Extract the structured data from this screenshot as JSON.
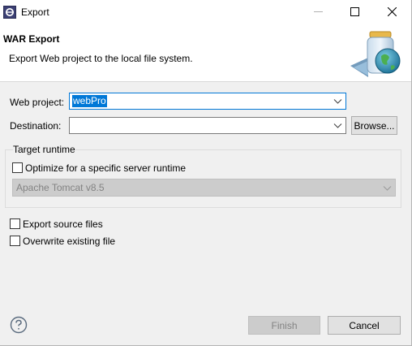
{
  "window": {
    "title": "Export"
  },
  "banner": {
    "title": "WAR Export",
    "description": "Export Web project to the local file system."
  },
  "form": {
    "web_project_label": "Web project:",
    "web_project_value": "webPro",
    "destination_label": "Destination:",
    "destination_value": "",
    "browse_label": "Browse..."
  },
  "target_runtime": {
    "group_title": "Target runtime",
    "optimize_label": "Optimize for a specific server runtime",
    "optimize_checked": false,
    "runtime_value": "Apache Tomcat v8.5"
  },
  "options": {
    "export_source_label": "Export source files",
    "export_source_checked": false,
    "overwrite_label": "Overwrite existing file",
    "overwrite_checked": false
  },
  "footer": {
    "finish_label": "Finish",
    "cancel_label": "Cancel"
  },
  "colors": {
    "accent": "#0078d7",
    "window_bg": "#f0f0f0",
    "disabled_bg": "#cccccc"
  },
  "icons": {
    "app": "eclipse-icon",
    "minimize": "minimize-icon",
    "maximize": "maximize-icon",
    "close": "close-icon",
    "help": "help-icon",
    "banner": "war-jar-globe-icon"
  }
}
